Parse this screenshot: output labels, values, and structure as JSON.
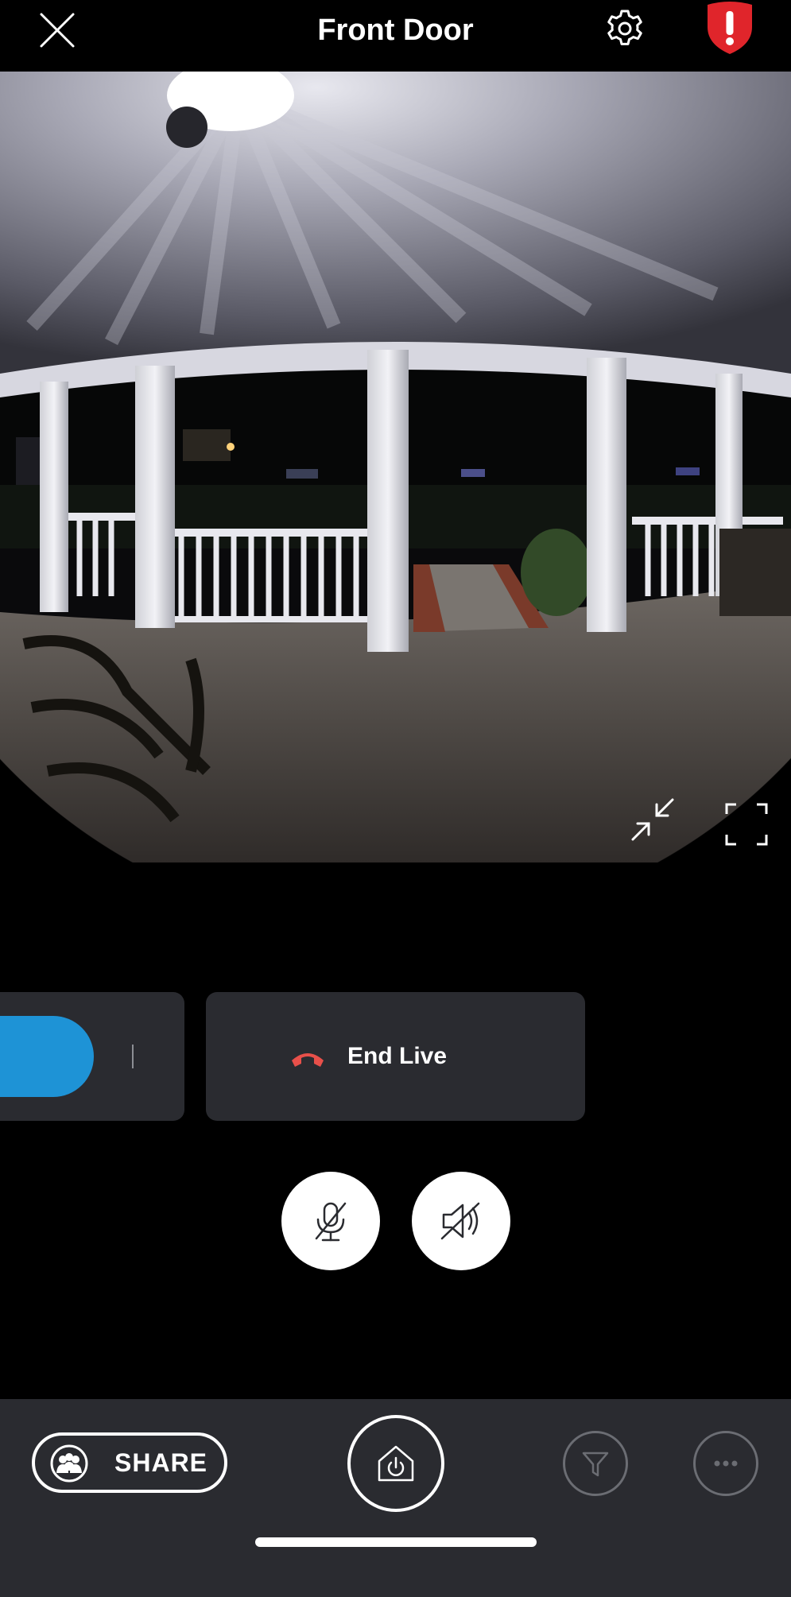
{
  "header": {
    "title": "Front Door",
    "close_icon": "close-icon",
    "settings_icon": "gear-icon",
    "alert_icon": "alert-shield-icon"
  },
  "video": {
    "pip_icon": "minimize-arrows-icon",
    "fullscreen_icon": "fullscreen-icon"
  },
  "controls": {
    "end_live_label": "End Live",
    "end_live_icon": "phone-hangup-icon",
    "mic_icon": "microphone-muted-icon",
    "speaker_icon": "speaker-muted-icon"
  },
  "bottom_bar": {
    "share_label": "SHARE",
    "share_icon": "neighbors-icon",
    "mode_icon": "home-power-icon",
    "filter_icon": "filter-icon",
    "more_icon": "more-dots-icon"
  },
  "colors": {
    "accent_blue": "#1e93d6",
    "alert_red": "#e0252b",
    "hangup_red": "#e8504a",
    "panel": "#2a2b30"
  }
}
